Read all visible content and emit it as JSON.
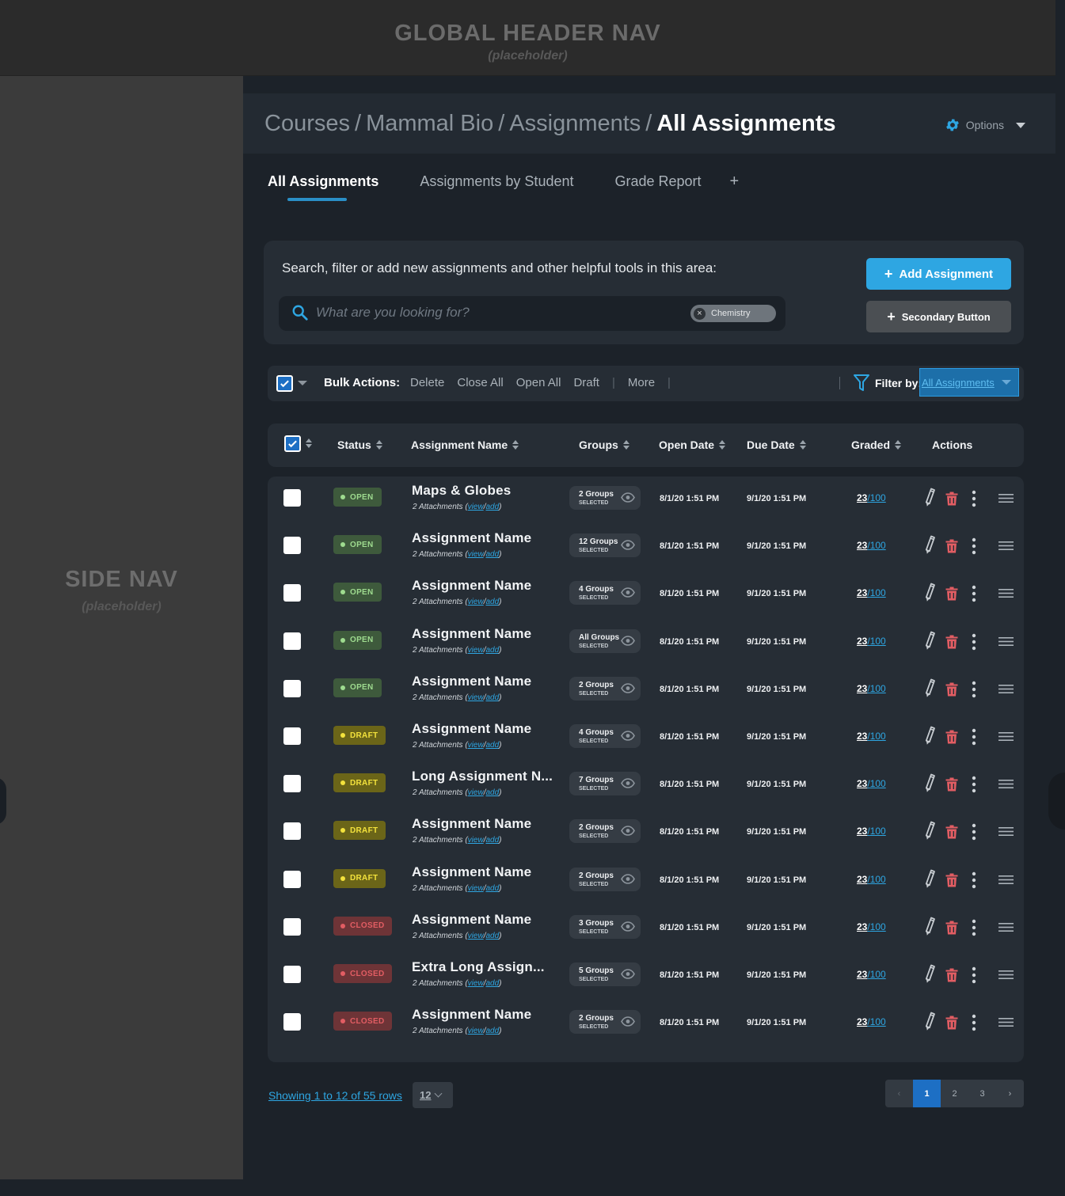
{
  "global_header": {
    "title": "GLOBAL HEADER NAV",
    "subtitle": "(placeholder)"
  },
  "side_nav": {
    "title": "SIDE NAV",
    "subtitle": "(placeholder)"
  },
  "breadcrumb": {
    "items": [
      "Courses",
      "Mammal Bio",
      "Assignments"
    ],
    "separator": "/",
    "current": "All Assignments"
  },
  "options": {
    "label": "Options",
    "icon": "gear-icon"
  },
  "tabs": [
    {
      "label": "All Assignments",
      "active": true
    },
    {
      "label": "Assignments by Student",
      "active": false
    },
    {
      "label": "Grade Report",
      "active": false
    }
  ],
  "tab_add_label": "+",
  "tools": {
    "description": "Search, filter or add new assignments and other helpful tools in this area:",
    "search_placeholder": "What are you looking for?",
    "filter_chip": "Chemistry",
    "add_button": "Add Assignment",
    "secondary_button": "Secondary Button"
  },
  "bulk": {
    "label": "Bulk Actions:",
    "actions": [
      "Delete",
      "Close All",
      "Open All",
      "Draft"
    ],
    "more": "More",
    "filter_label": "Filter by:",
    "filter_value": "All Assignments"
  },
  "table": {
    "headers": {
      "status": "Status",
      "name": "Assignment Name",
      "groups": "Groups",
      "open_date": "Open Date",
      "due_date": "Due Date",
      "graded": "Graded",
      "actions": "Actions"
    },
    "attachments_label": "2 Attachments",
    "attach_view": "view",
    "attach_add": "add",
    "groups_selected_label": "SELECTED",
    "rows": [
      {
        "status": "OPEN",
        "name": "Maps & Globes",
        "groups": "2 Groups",
        "open": "8/1/20 1:51 PM",
        "due": "9/1/20 1:51 PM",
        "graded": "23",
        "total": "100"
      },
      {
        "status": "OPEN",
        "name": "Assignment Name",
        "groups": "12 Groups",
        "open": "8/1/20 1:51 PM",
        "due": "9/1/20 1:51 PM",
        "graded": "23",
        "total": "100"
      },
      {
        "status": "OPEN",
        "name": "Assignment Name",
        "groups": "4 Groups",
        "open": "8/1/20 1:51 PM",
        "due": "9/1/20 1:51 PM",
        "graded": "23",
        "total": "100"
      },
      {
        "status": "OPEN",
        "name": "Assignment Name",
        "groups": "All Groups",
        "open": "8/1/20 1:51 PM",
        "due": "9/1/20 1:51 PM",
        "graded": "23",
        "total": "100"
      },
      {
        "status": "OPEN",
        "name": "Assignment Name",
        "groups": "2 Groups",
        "open": "8/1/20 1:51 PM",
        "due": "9/1/20 1:51 PM",
        "graded": "23",
        "total": "100"
      },
      {
        "status": "DRAFT",
        "name": "Assignment Name",
        "groups": "4 Groups",
        "open": "8/1/20 1:51 PM",
        "due": "9/1/20 1:51 PM",
        "graded": "23",
        "total": "100"
      },
      {
        "status": "DRAFT",
        "name": "Long Assignment N...",
        "groups": "7 Groups",
        "open": "8/1/20 1:51 PM",
        "due": "9/1/20 1:51 PM",
        "graded": "23",
        "total": "100"
      },
      {
        "status": "DRAFT",
        "name": "Assignment Name",
        "groups": "2 Groups",
        "open": "8/1/20 1:51 PM",
        "due": "9/1/20 1:51 PM",
        "graded": "23",
        "total": "100"
      },
      {
        "status": "DRAFT",
        "name": "Assignment Name",
        "groups": "2 Groups",
        "open": "8/1/20 1:51 PM",
        "due": "9/1/20 1:51 PM",
        "graded": "23",
        "total": "100"
      },
      {
        "status": "CLOSED",
        "name": "Assignment Name",
        "groups": "3 Groups",
        "open": "8/1/20 1:51 PM",
        "due": "9/1/20 1:51 PM",
        "graded": "23",
        "total": "100"
      },
      {
        "status": "CLOSED",
        "name": "Extra Long Assign...",
        "groups": "5 Groups",
        "open": "8/1/20 1:51 PM",
        "due": "9/1/20 1:51 PM",
        "graded": "23",
        "total": "100"
      },
      {
        "status": "CLOSED",
        "name": "Assignment Name",
        "groups": "2 Groups",
        "open": "8/1/20 1:51 PM",
        "due": "9/1/20 1:51 PM",
        "graded": "23",
        "total": "100"
      }
    ]
  },
  "footer": {
    "rows_info": "Showing 1 to 12 of 55 rows",
    "page_size": "12",
    "pages": [
      "1",
      "2",
      "3"
    ],
    "current_page": "1",
    "prev": "‹",
    "next": "›"
  },
  "colors": {
    "accent": "#2ea6e2",
    "open": "#9edb8f",
    "draft": "#f3e23c",
    "closed": "#e25d63"
  }
}
